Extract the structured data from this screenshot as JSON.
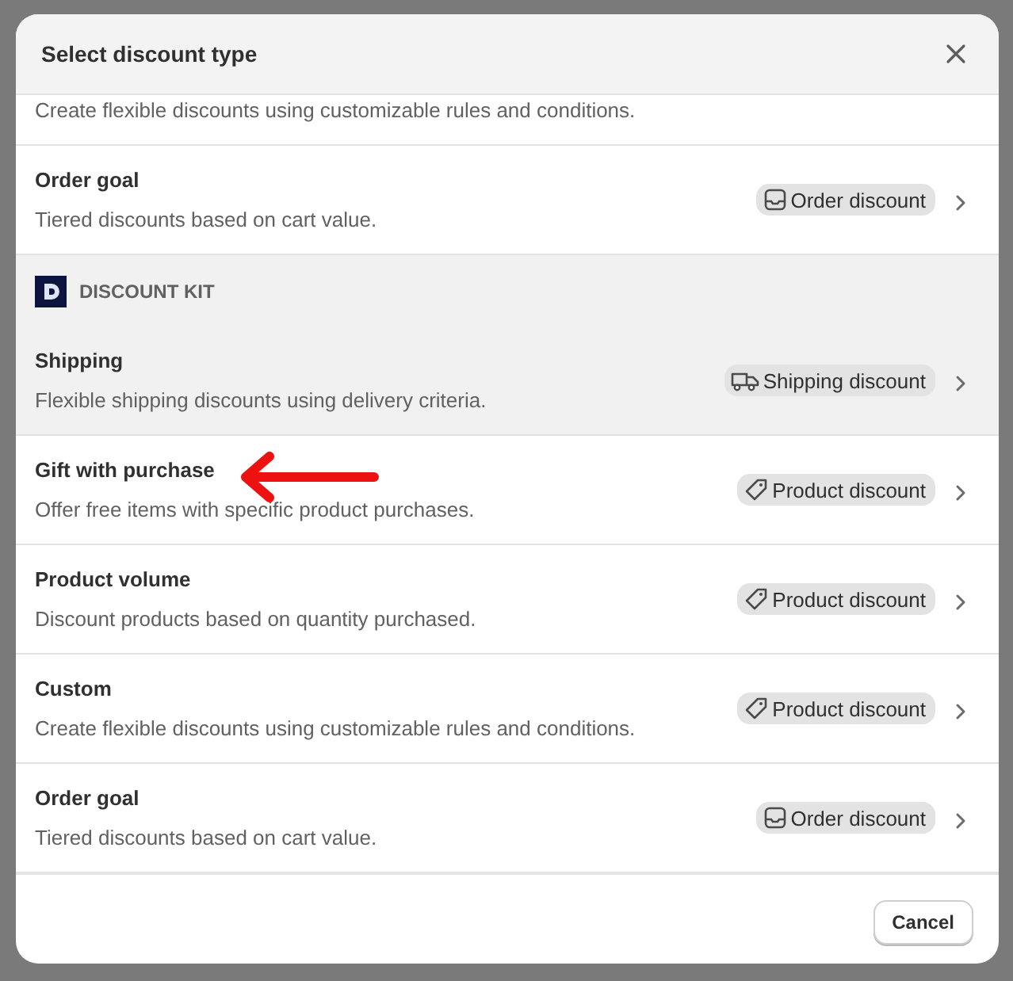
{
  "modal": {
    "title": "Select discount type"
  },
  "items": [
    {
      "kind": "row",
      "description": "Create flexible discounts using customizable rules and conditions.",
      "hovered": false
    },
    {
      "kind": "row",
      "title": "Order goal",
      "description": "Tiered discounts based on cart value.",
      "badge": {
        "kind": "order",
        "label": "Order discount"
      },
      "hovered": false
    },
    {
      "kind": "group",
      "label": "DISCOUNT KIT"
    },
    {
      "kind": "row",
      "title": "Shipping",
      "description": "Flexible shipping discounts using delivery criteria.",
      "badge": {
        "kind": "shipping",
        "label": "Shipping discount"
      },
      "hovered": true
    },
    {
      "kind": "row",
      "title": "Gift with purchase",
      "description": "Offer free items with specific product purchases.",
      "badge": {
        "kind": "product",
        "label": "Product discount"
      },
      "hovered": false
    },
    {
      "kind": "row",
      "title": "Product volume",
      "description": "Discount products based on quantity purchased.",
      "badge": {
        "kind": "product",
        "label": "Product discount"
      },
      "hovered": false
    },
    {
      "kind": "row",
      "title": "Custom",
      "description": "Create flexible discounts using customizable rules and conditions.",
      "badge": {
        "kind": "product",
        "label": "Product discount"
      },
      "hovered": false
    },
    {
      "kind": "row",
      "title": "Order goal",
      "description": "Tiered discounts based on cart value.",
      "badge": {
        "kind": "order",
        "label": "Order discount"
      },
      "hovered": false
    }
  ],
  "footer": {
    "cancel": "Cancel"
  }
}
